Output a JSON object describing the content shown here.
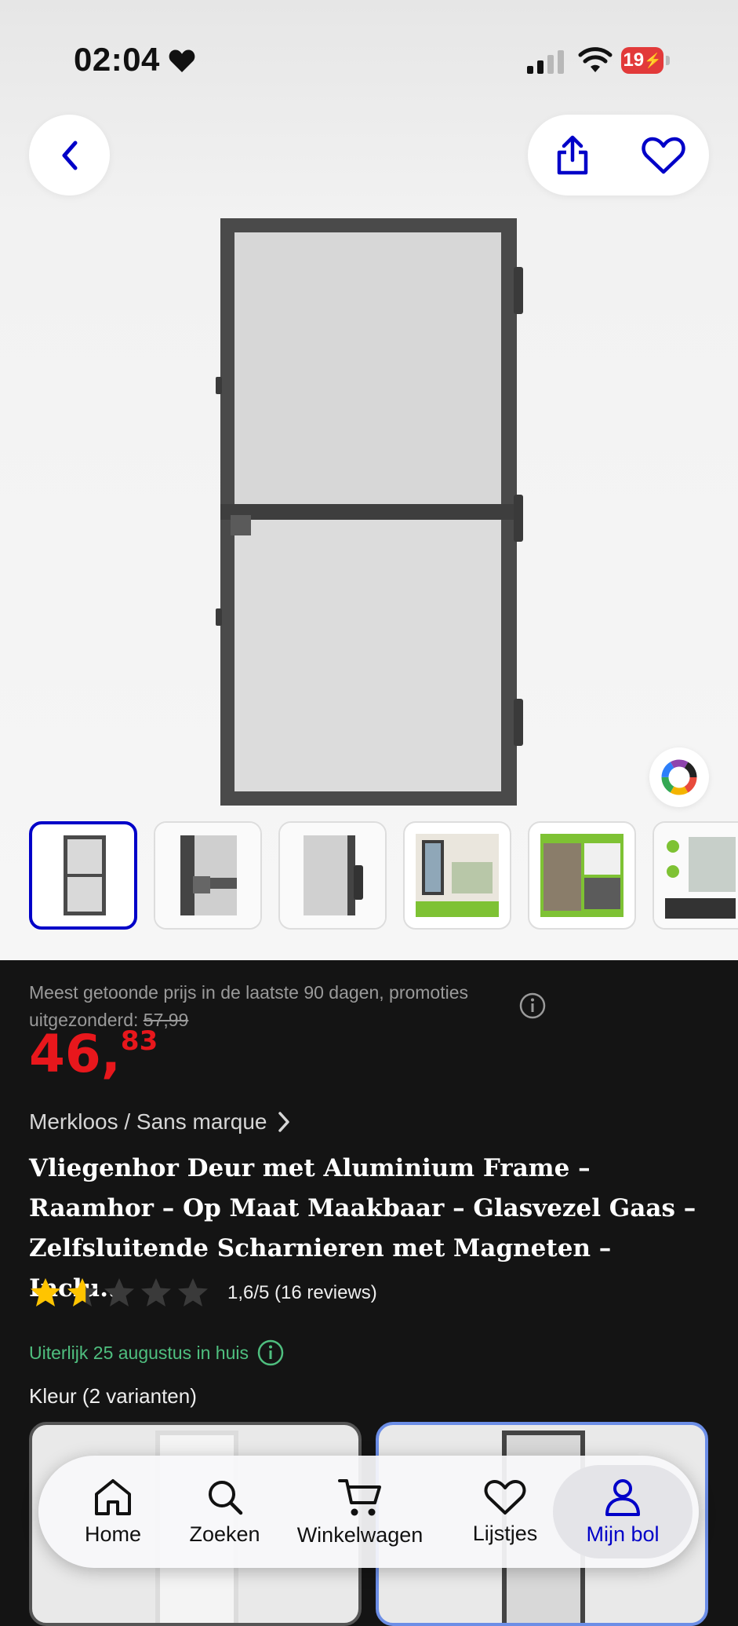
{
  "status_bar": {
    "time": "02:04",
    "battery": "19"
  },
  "header": {
    "back_icon": "chevron-left-icon",
    "share_icon": "share-icon",
    "favorite_icon": "heart-outline-icon"
  },
  "gallery": {
    "thumbnail_count": 6,
    "selected_index": 0
  },
  "price": {
    "note": "Meest getoonde prijs in de laatste 90 dagen, promoties uitgezonderd:",
    "old_price": "57,99",
    "euros": "46,",
    "cents": "83"
  },
  "product": {
    "brand": "Merkloos / Sans marque",
    "title": "Vliegenhor Deur met Aluminium Frame – Raamhor – Op Maat Maakbaar – Glasvezel Gaas – Zelfsluitende Scharnieren met Magneten – Inclu...",
    "rating_value": 1.6,
    "rating_text": "1,6/5 (16 reviews)",
    "delivery": "Uiterlijk 25 augustus in huis",
    "variants_label": "Kleur (2 varianten)"
  },
  "bottom_nav": [
    {
      "label": "Home",
      "icon": "home-icon"
    },
    {
      "label": "Zoeken",
      "icon": "search-icon"
    },
    {
      "label": "Winkelwagen",
      "icon": "cart-icon"
    },
    {
      "label": "Lijstjes",
      "icon": "heart-icon"
    },
    {
      "label": "Mijn bol",
      "icon": "user-icon"
    }
  ],
  "colors": {
    "accent": "#0000c8",
    "price": "#e8171c",
    "delivery": "#4fbf7f",
    "star": "#ffc400"
  }
}
